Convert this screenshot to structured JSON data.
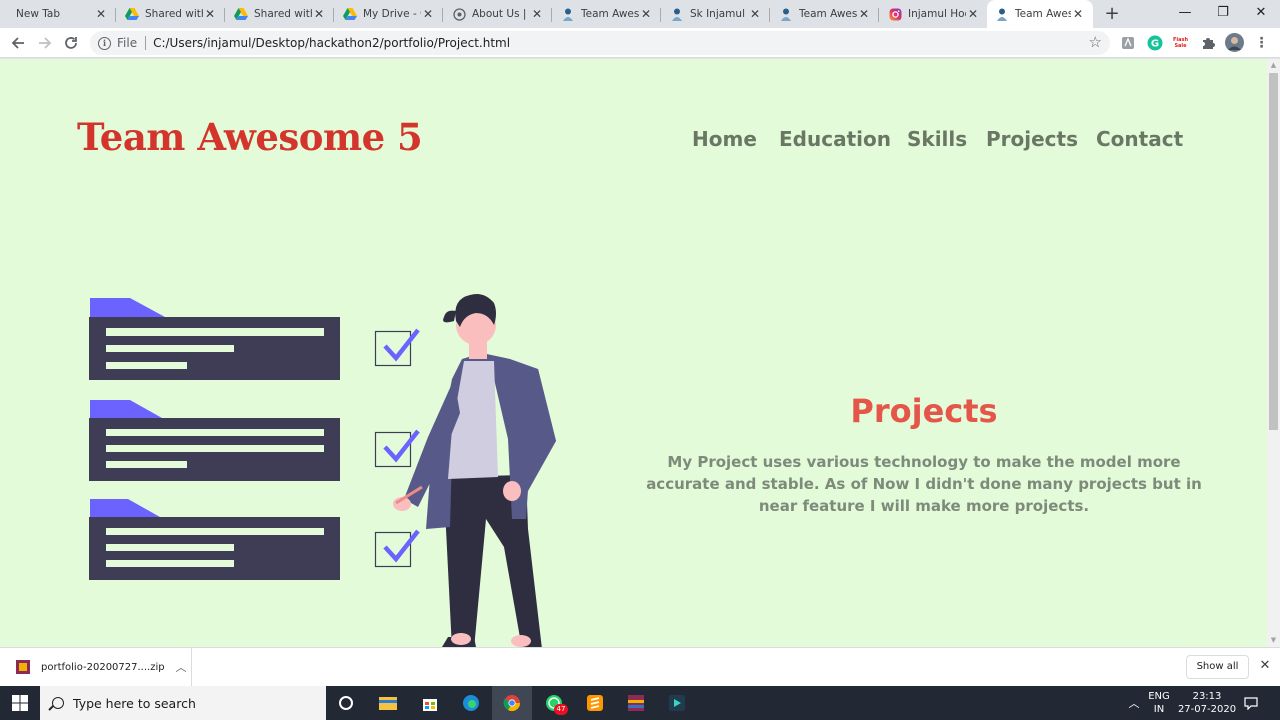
{
  "browser": {
    "tabs": [
      {
        "title": "New Tab",
        "icon": "none"
      },
      {
        "title": "Shared with",
        "icon": "google-drive-icon"
      },
      {
        "title": "Shared with",
        "icon": "google-drive-icon"
      },
      {
        "title": "My Drive - G",
        "icon": "google-drive-icon"
      },
      {
        "title": "About Us | E",
        "icon": "site-icon"
      },
      {
        "title": "Team Aweso",
        "icon": "person-icon"
      },
      {
        "title": "Sk Injamul H",
        "icon": "person-icon"
      },
      {
        "title": "Team Aweso",
        "icon": "person-icon"
      },
      {
        "title": "Injamul Hoq",
        "icon": "instagram-icon"
      },
      {
        "title": "Team Aweso",
        "icon": "person-icon",
        "active": true
      }
    ],
    "new_tab_symbol": "+",
    "window_controls": {
      "minimize": "—",
      "restore": "❐",
      "close": "✕"
    },
    "address": {
      "scheme": "File",
      "url": "C:/Users/injamul/Desktop/hackathon2/portfolio/Project.html"
    },
    "extensions": [
      "pdf-icon",
      "grammarly-icon",
      "flash-sale-icon",
      "puzzle-icon",
      "avatar"
    ],
    "flash_sale_text": "Flash Sale"
  },
  "page": {
    "logo": "Team Awesome 5",
    "nav": [
      {
        "label": "Home"
      },
      {
        "label": "Education"
      },
      {
        "label": "Skills"
      },
      {
        "label": "Projects"
      },
      {
        "label": "Contact"
      }
    ],
    "section_title": "Projects",
    "section_text": "My Project uses various technology to make the model more accurate and stable. As of Now I didn't done many projects but in near feature I will make more projects.",
    "colors": {
      "background": "#e3fbd9",
      "logo": "#d3342c",
      "nav": "#6a7764",
      "title": "#e5564a",
      "text": "#7e8a7a",
      "card": "#3f3d56",
      "accent": "#6c63ff"
    }
  },
  "downloads": {
    "file_name": "portfolio-20200727....zip",
    "show_all": "Show all",
    "close_symbol": "✕"
  },
  "taskbar": {
    "search_placeholder": "Type here to search",
    "apps": [
      "cortana-icon",
      "file-explorer-icon",
      "store-icon",
      "edge-icon",
      "chrome-icon",
      "whatsapp-icon",
      "sublime-text-icon",
      "winrar-icon",
      "filmora-icon"
    ],
    "whatsapp_badge": "47",
    "language": {
      "line1": "ENG",
      "line2": "IN"
    },
    "clock": {
      "time": "23:13",
      "date": "27-07-2020"
    }
  }
}
